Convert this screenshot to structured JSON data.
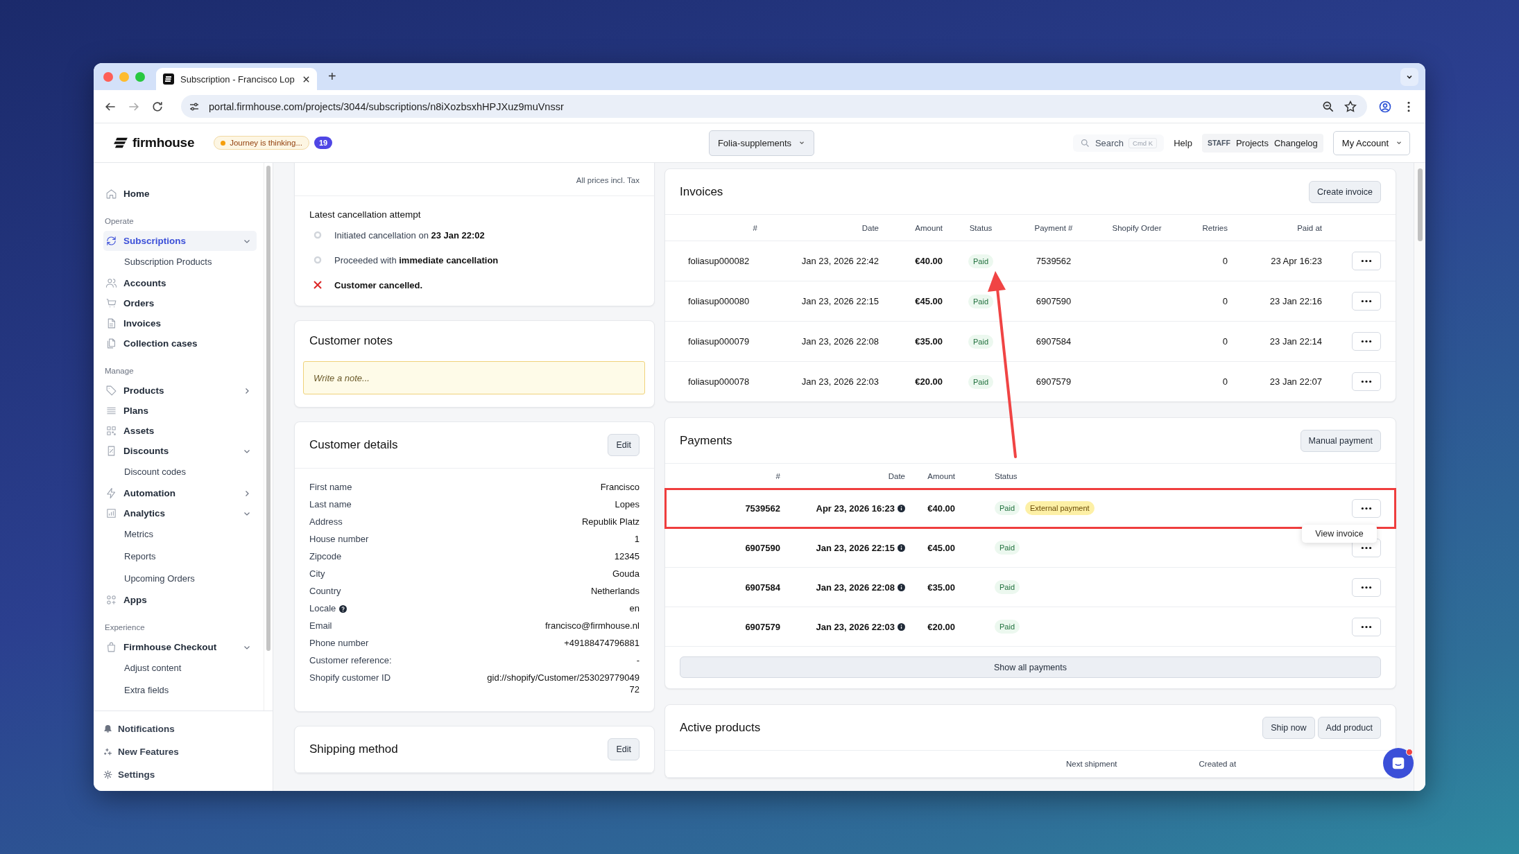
{
  "browser": {
    "tab_title": "Subscription - Francisco Lop",
    "new_tab": "+",
    "url": "portal.firmhouse.com/projects/3044/subscriptions/n8iXozbsxhHPJXuz9muVnssr"
  },
  "header": {
    "logo": "firmhouse",
    "journey_badge": "Journey is thinking...",
    "count": "19",
    "project": "Folia-supplements",
    "search_placeholder": "Search",
    "search_shortcut": "Cmd K",
    "help": "Help",
    "staff_label": "STAFF",
    "staff_links": [
      "Projects",
      "Changelog"
    ],
    "account": "My Account"
  },
  "sidebar": {
    "sections": [
      {
        "items": [
          {
            "label": "Home",
            "selected": false
          }
        ]
      },
      {
        "heading": "Operate",
        "items": [
          {
            "label": "Subscriptions",
            "selected": true,
            "expanded": true,
            "children": [
              {
                "label": "Subscription Products",
                "selected": false
              }
            ]
          },
          {
            "label": "Accounts",
            "selected": false
          },
          {
            "label": "Orders",
            "selected": false
          },
          {
            "label": "Invoices",
            "selected": false
          },
          {
            "label": "Collection cases",
            "selected": false
          }
        ]
      },
      {
        "heading": "Manage",
        "items": [
          {
            "label": "Products",
            "selected": false,
            "expanded": false
          },
          {
            "label": "Plans",
            "selected": false
          },
          {
            "label": "Assets",
            "selected": false
          },
          {
            "label": "Discounts",
            "selected": false,
            "expanded": true,
            "children": [
              {
                "label": "Discount codes",
                "selected": false
              }
            ]
          },
          {
            "label": "Automation",
            "selected": false,
            "expanded": false
          },
          {
            "label": "Analytics",
            "selected": false,
            "expanded": true,
            "children": [
              {
                "label": "Metrics",
                "selected": false
              },
              {
                "label": "Reports",
                "selected": false
              },
              {
                "label": "Upcoming Orders",
                "selected": false
              }
            ]
          },
          {
            "label": "Apps",
            "selected": false
          }
        ]
      },
      {
        "heading": "Experience",
        "items": [
          {
            "label": "Firmhouse Checkout",
            "selected": false,
            "expanded": true,
            "children": [
              {
                "label": "Adjust content",
                "selected": false
              },
              {
                "label": "Extra fields",
                "selected": false
              }
            ]
          }
        ]
      }
    ],
    "footer": [
      {
        "label": "Notifications"
      },
      {
        "label": "New Features"
      },
      {
        "label": "Settings"
      }
    ]
  },
  "summary": {
    "prices_note": "All prices incl. Tax"
  },
  "cancellation": {
    "title": "Latest cancellation attempt",
    "steps": [
      {
        "kind": "pending",
        "text": "Initiated cancellation on **23 Jan 22:02**"
      },
      {
        "kind": "pending",
        "text": "Proceeded with **immediate cancellation**"
      },
      {
        "kind": "cancelled",
        "text": "Customer cancelled."
      }
    ]
  },
  "customer_notes": {
    "title": "Customer notes",
    "placeholder": "Write a note..."
  },
  "customer_details": {
    "title": "Customer details",
    "edit": "Edit",
    "fields": [
      {
        "label": "First name",
        "value": "Francisco",
        "info": false
      },
      {
        "label": "Last name",
        "value": "Lopes",
        "info": false
      },
      {
        "label": "Address",
        "value": "Republik Platz",
        "info": false
      },
      {
        "label": "House number",
        "value": "1",
        "info": false
      },
      {
        "label": "Zipcode",
        "value": "12345",
        "info": false
      },
      {
        "label": "City",
        "value": "Gouda",
        "info": false
      },
      {
        "label": "Country",
        "value": "Netherlands",
        "info": false
      },
      {
        "label": "Locale",
        "value": "en",
        "info": true
      },
      {
        "label": "Email",
        "value": "francisco@firmhouse.nl",
        "info": false
      },
      {
        "label": "Phone number",
        "value": "+49188474796881",
        "info": false
      },
      {
        "label": "Customer reference:",
        "value": "-",
        "info": false
      },
      {
        "label": "Shopify customer ID",
        "value": "gid://shopify/Customer/25302977904972",
        "info": false
      }
    ]
  },
  "shipping_method": {
    "title": "Shipping method",
    "edit": "Edit"
  },
  "invoices": {
    "title": "Invoices",
    "create": "Create invoice",
    "columns": [
      "#",
      "Date",
      "Amount",
      "Status",
      "Payment #",
      "Shopify Order",
      "Retries",
      "Paid at"
    ],
    "rows": [
      {
        "number": "foliasup000082",
        "date": "Jan 23, 2026 22:42",
        "amount": "€40.00",
        "status": {
          "text": "Paid",
          "kind": "success"
        },
        "payment": "7539562",
        "retries": "0",
        "paid_at": "23 Apr 16:23"
      },
      {
        "number": "foliasup000080",
        "date": "Jan 23, 2026 22:15",
        "amount": "€45.00",
        "status": {
          "text": "Paid",
          "kind": "success"
        },
        "payment": "6907590",
        "retries": "0",
        "paid_at": "23 Jan 22:16"
      },
      {
        "number": "foliasup000079",
        "date": "Jan 23, 2026 22:08",
        "amount": "€35.00",
        "status": {
          "text": "Paid",
          "kind": "success"
        },
        "payment": "6907584",
        "retries": "0",
        "paid_at": "23 Jan 22:14"
      },
      {
        "number": "foliasup000078",
        "date": "Jan 23, 2026 22:03",
        "amount": "€20.00",
        "status": {
          "text": "Paid",
          "kind": "success"
        },
        "payment": "6907579",
        "retries": "0",
        "paid_at": "23 Jan 22:07"
      }
    ]
  },
  "payments": {
    "title": "Payments",
    "manual": "Manual payment",
    "columns": [
      "#",
      "Date",
      "Amount",
      "Status"
    ],
    "rows": [
      {
        "number": "7539562",
        "date": "Apr 23, 2026 16:23",
        "amount": "€40.00",
        "status": {
          "text": "Paid",
          "kind": "success"
        },
        "tag": {
          "text": "External payment",
          "kind": "warning"
        },
        "highlighted": true,
        "menu": [
          "View invoice"
        ]
      },
      {
        "number": "6907590",
        "date": "Jan 23, 2026 22:15",
        "amount": "€45.00",
        "status": {
          "text": "Paid",
          "kind": "success"
        },
        "highlighted": false
      },
      {
        "number": "6907584",
        "date": "Jan 23, 2026 22:08",
        "amount": "€35.00",
        "status": {
          "text": "Paid",
          "kind": "success"
        },
        "highlighted": false
      },
      {
        "number": "6907579",
        "date": "Jan 23, 2026 22:03",
        "amount": "€20.00",
        "status": {
          "text": "Paid",
          "kind": "success"
        },
        "highlighted": false
      }
    ],
    "show_all": "Show all payments"
  },
  "active_products": {
    "title": "Active products",
    "buttons": [
      "Ship now",
      "Add product"
    ],
    "columns": [
      "Next shipment",
      "Created at"
    ]
  }
}
